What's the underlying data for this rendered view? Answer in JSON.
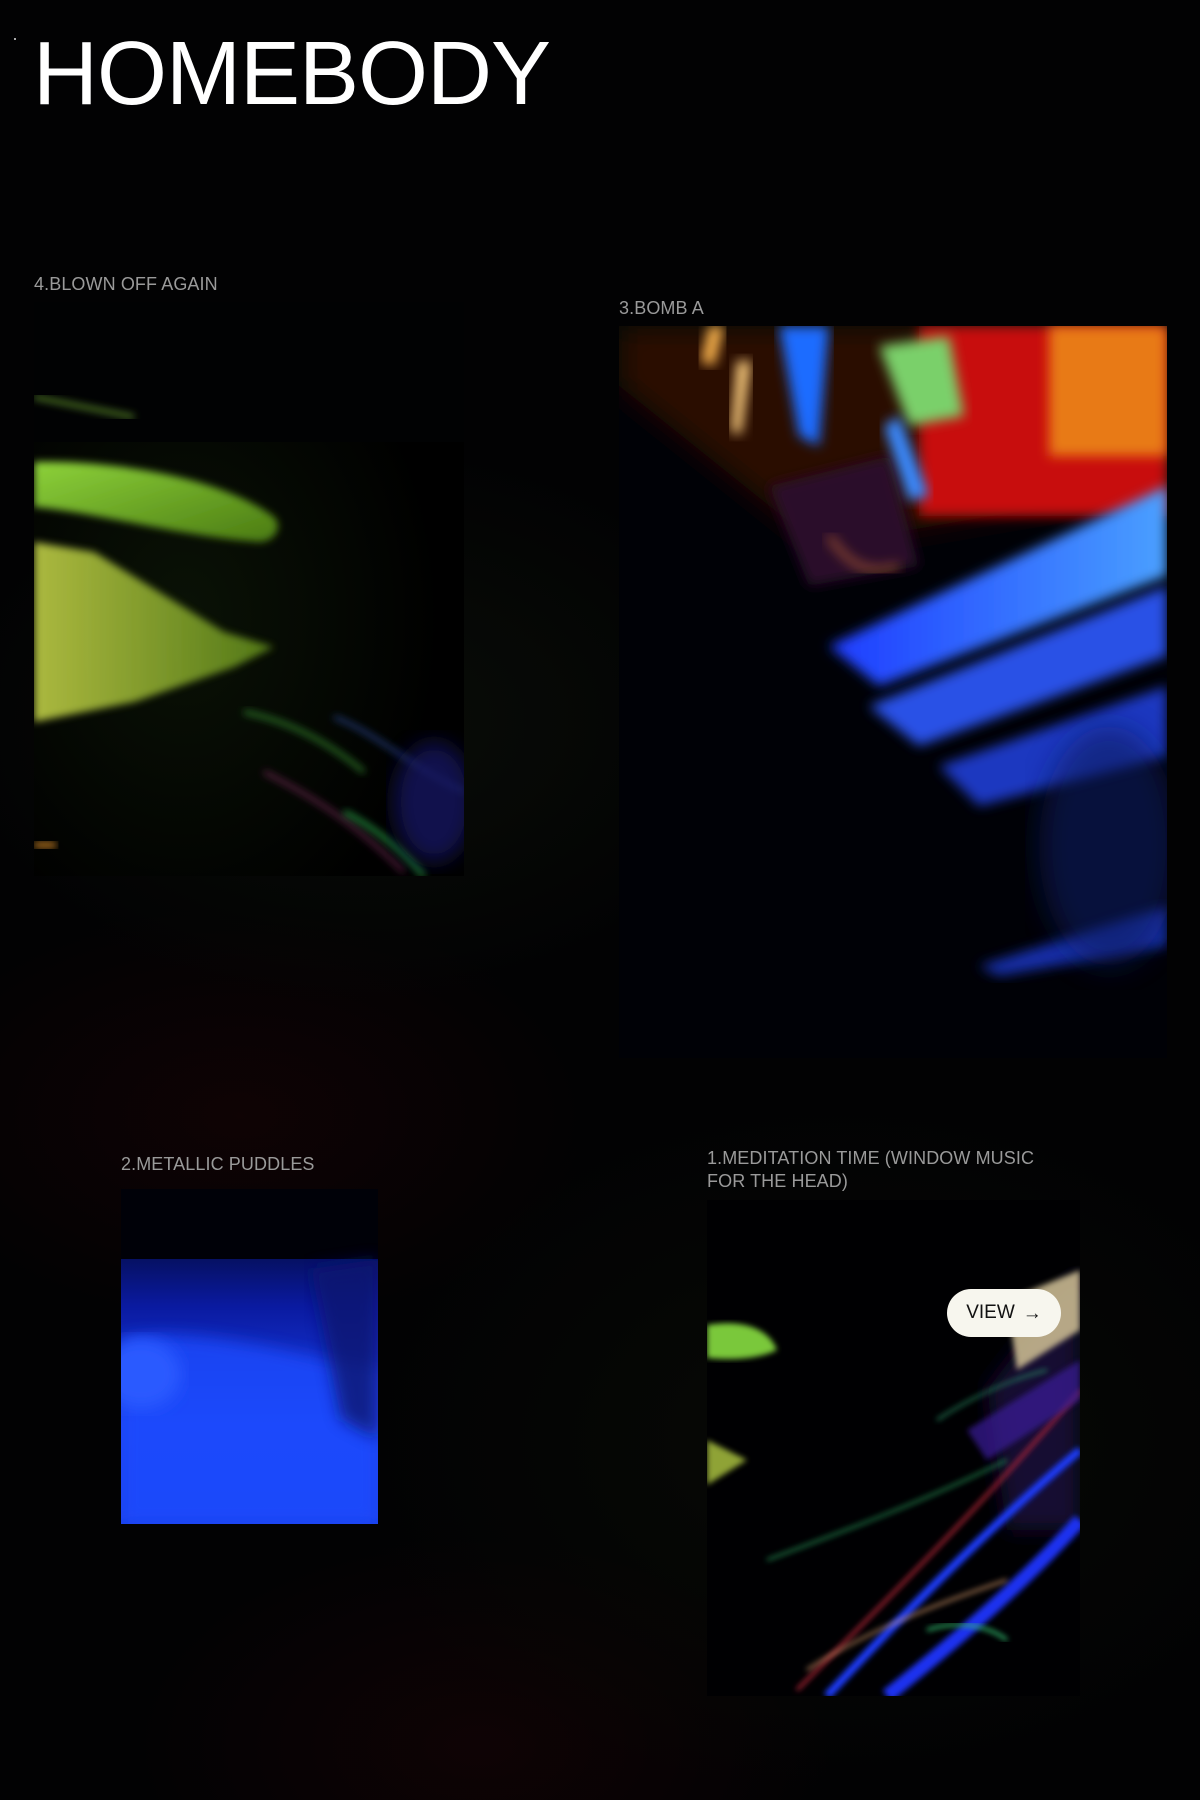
{
  "header": {
    "title": "HOMEBODY"
  },
  "tracks": [
    {
      "label": "4.BLOWN OFF AGAIN"
    },
    {
      "label": "3.BOMB A"
    },
    {
      "label": "2.METALLIC PUDDLES"
    },
    {
      "label": "1.MEDITATION TIME (WINDOW MUSIC FOR THE HEAD)"
    }
  ],
  "view_button": {
    "label": "VIEW",
    "icon": "arrow-right-icon",
    "arrow": "→"
  },
  "colors": {
    "background": "#020202",
    "title": "#ffffff",
    "label": "#9a9a9a",
    "button_bg": "#f7f6ee"
  }
}
